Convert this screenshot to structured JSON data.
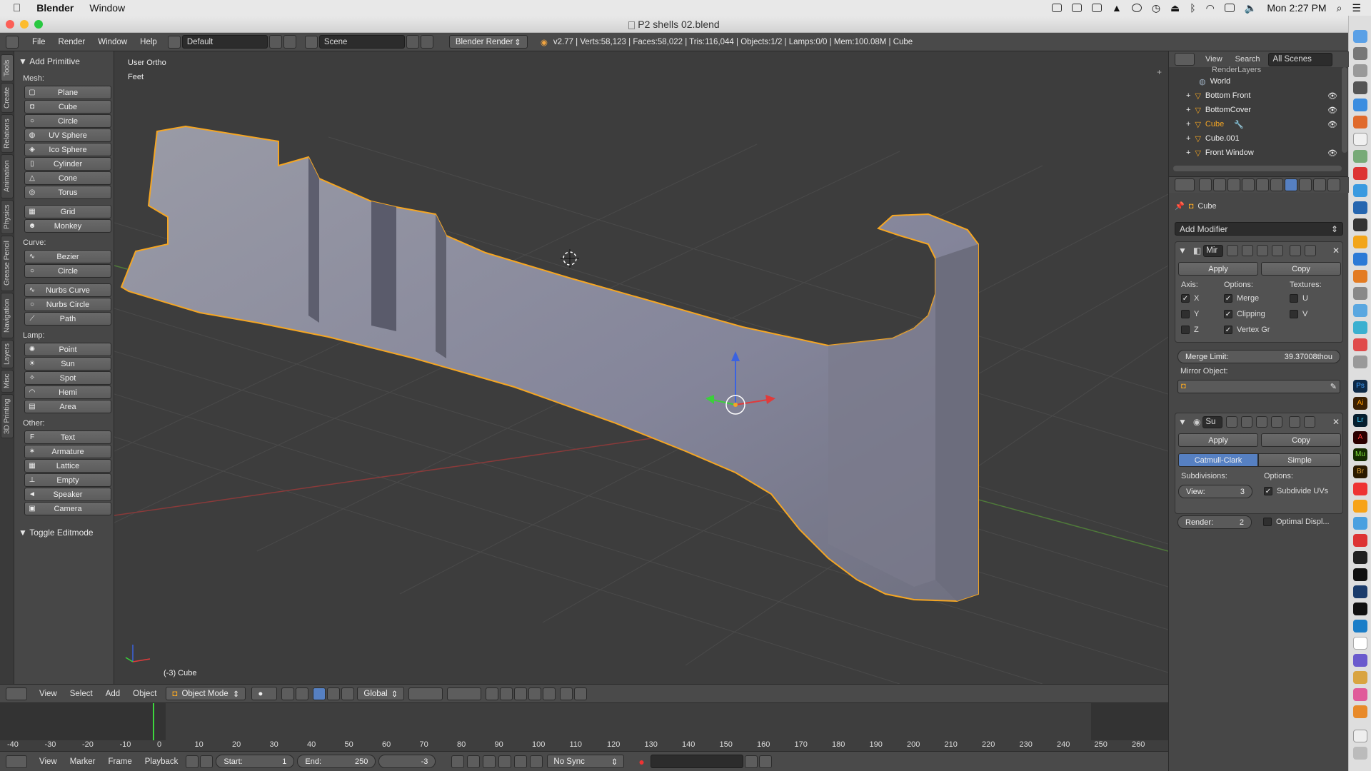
{
  "macbar": {
    "app": "Blender",
    "menu_window": "Window",
    "clock": "Mon 2:27 PM"
  },
  "window": {
    "title": "P2 shells 02.blend"
  },
  "infobar": {
    "menus": [
      "File",
      "Render",
      "Window",
      "Help"
    ],
    "layout": "Default",
    "scene": "Scene",
    "engine": "Blender Render",
    "stats": "v2.77 | Verts:58,123 | Faces:58,022 | Tris:116,044 | Objects:1/2 | Lamps:0/0 | Mem:100.08M | Cube"
  },
  "tabs": [
    "Tools",
    "Create",
    "Relations",
    "Animation",
    "Physics",
    "Grease Pencil",
    "Navigation",
    "Layers",
    "Misc",
    "3D Printing"
  ],
  "shelf": {
    "panel_title": "Add Primitive",
    "mesh_label": "Mesh:",
    "mesh": [
      "Plane",
      "Cube",
      "Circle",
      "UV Sphere",
      "Ico Sphere",
      "Cylinder",
      "Cone",
      "Torus"
    ],
    "mesh2": [
      "Grid",
      "Monkey"
    ],
    "curve_label": "Curve:",
    "curve": [
      "Bezier",
      "Circle"
    ],
    "curve2": [
      "Nurbs Curve",
      "Nurbs Circle",
      "Path"
    ],
    "lamp_label": "Lamp:",
    "lamp": [
      "Point",
      "Sun",
      "Spot",
      "Hemi",
      "Area"
    ],
    "other_label": "Other:",
    "other": [
      "Text",
      "Armature",
      "Lattice",
      "Empty",
      "Speaker",
      "Camera"
    ],
    "toggle": "Toggle Editmode"
  },
  "viewport": {
    "view_name": "User Ortho",
    "units": "Feet",
    "object_label": "(-3) Cube"
  },
  "vphead": {
    "menus": [
      "View",
      "Select",
      "Add",
      "Object"
    ],
    "mode": "Object Mode",
    "orientation": "Global"
  },
  "timeline": {
    "ticks": [
      "-40",
      "-30",
      "-20",
      "-10",
      "0",
      "10",
      "20",
      "30",
      "40",
      "50",
      "60",
      "70",
      "80",
      "90",
      "100",
      "110",
      "120",
      "130",
      "140",
      "150",
      "160",
      "170",
      "180",
      "190",
      "200",
      "210",
      "220",
      "230",
      "240",
      "250",
      "260"
    ],
    "current_frame": -3,
    "menus": [
      "View",
      "Marker",
      "Frame",
      "Playback"
    ],
    "start_label": "Start:",
    "start": "1",
    "end_label": "End:",
    "end": "250",
    "current": "-3",
    "sync": "No Sync"
  },
  "outliner": {
    "menus": [
      "View",
      "Search"
    ],
    "filter": "All Scenes",
    "rows": [
      "RenderLayers",
      "World",
      "Bottom Front",
      "BottomCover",
      "Cube",
      "Cube.001",
      "Front Window"
    ]
  },
  "properties": {
    "context": "Cube",
    "add_modifier": "Add Modifier",
    "mirror": {
      "name": "Mir",
      "apply": "Apply",
      "copy": "Copy",
      "axis_label": "Axis:",
      "options_label": "Options:",
      "textures_label": "Textures:",
      "axis": [
        {
          "label": "X",
          "checked": true
        },
        {
          "label": "Y",
          "checked": false
        },
        {
          "label": "Z",
          "checked": false
        }
      ],
      "options": [
        {
          "label": "Merge",
          "checked": true
        },
        {
          "label": "Clipping",
          "checked": true
        },
        {
          "label": "Vertex Gr",
          "checked": true
        }
      ],
      "textures": [
        {
          "label": "U",
          "checked": false
        },
        {
          "label": "V",
          "checked": false
        }
      ],
      "merge_limit_label": "Merge Limit:",
      "merge_limit": "39.37008thou",
      "mirror_object_label": "Mirror Object:"
    },
    "subsurf": {
      "name": "Su",
      "apply": "Apply",
      "copy": "Copy",
      "catmull": "Catmull-Clark",
      "simple": "Simple",
      "subdivisions_label": "Subdivisions:",
      "options_label": "Options:",
      "view_label": "View:",
      "view": "3",
      "render_label": "Render:",
      "render": "2",
      "subdivide_uvs": "Subdivide UVs",
      "optimal_display": "Optimal Displ..."
    }
  },
  "colors": {
    "accent": "#5680c2",
    "selection": "#f5a623",
    "mesh": "#8a8b96"
  }
}
